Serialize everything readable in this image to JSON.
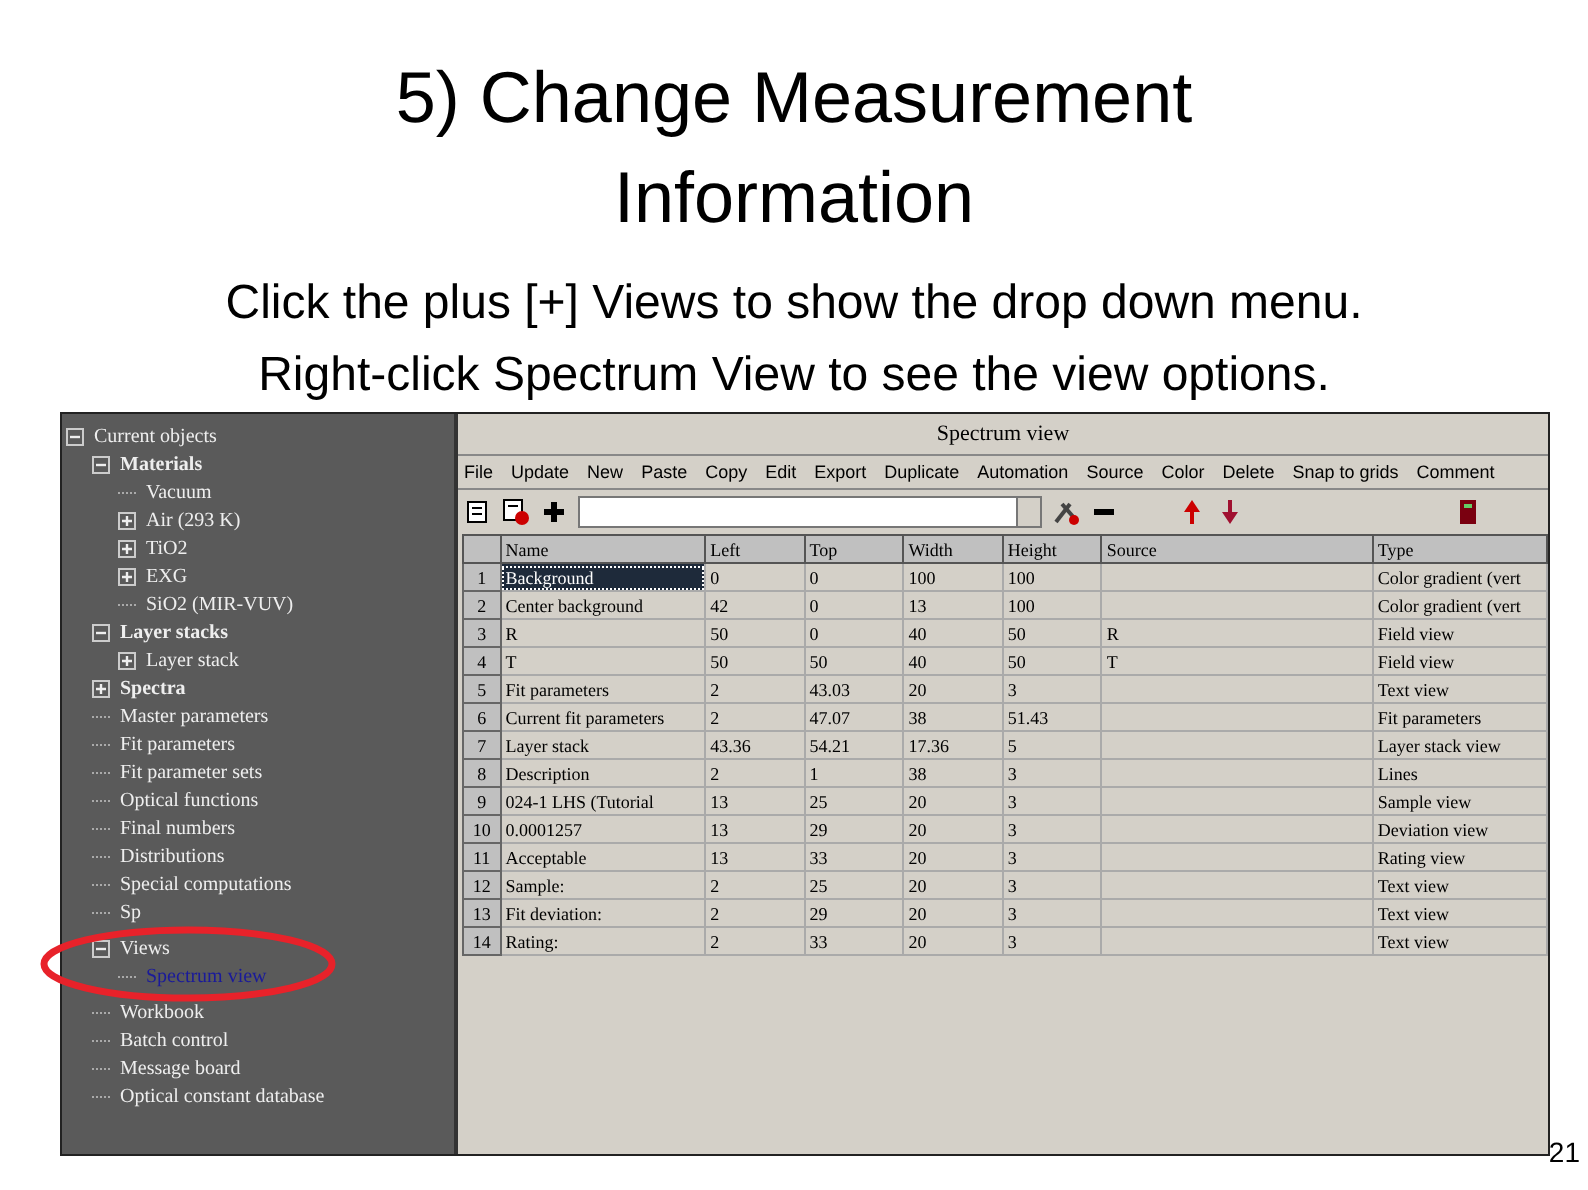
{
  "slide": {
    "title": [
      "5) Change Measurement",
      "Information"
    ],
    "subtitle": [
      "Click the plus [+] Views to show the drop down menu.",
      "Right-click Spectrum View to see the view options."
    ],
    "page_number": "21"
  },
  "tree": [
    {
      "label": "Current objects",
      "kind": "item",
      "expanded": true,
      "selected": false,
      "children": [
        {
          "label": "Materials",
          "kind": "group",
          "expanded": true,
          "selected": false,
          "children": [
            {
              "label": "Vacuum",
              "kind": "item",
              "selected": false
            },
            {
              "label": "Air (293 K)",
              "kind": "item",
              "expanded": false,
              "selected": false
            },
            {
              "label": "TiO2",
              "kind": "item",
              "expanded": false,
              "selected": false
            },
            {
              "label": "EXG",
              "kind": "item",
              "expanded": false,
              "selected": false
            },
            {
              "label": "SiO2 (MIR-VUV)",
              "kind": "item",
              "selected": false
            }
          ]
        },
        {
          "label": "Layer stacks",
          "kind": "group",
          "expanded": true,
          "selected": false,
          "children": [
            {
              "label": "Layer stack",
              "kind": "item",
              "expanded": false,
              "selected": false
            }
          ]
        },
        {
          "label": "Spectra",
          "kind": "group",
          "expanded": false,
          "selected": false
        },
        {
          "label": "Master parameters",
          "kind": "item",
          "selected": false
        },
        {
          "label": "Fit parameters",
          "kind": "item",
          "selected": false
        },
        {
          "label": "Fit parameter sets",
          "kind": "item",
          "selected": false
        },
        {
          "label": "Optical functions",
          "kind": "item",
          "selected": false
        },
        {
          "label": "Final numbers",
          "kind": "item",
          "selected": false
        },
        {
          "label": "Distributions",
          "kind": "item",
          "selected": false
        },
        {
          "label": "Special computations",
          "kind": "item",
          "selected": false
        },
        {
          "label": "Sp",
          "kind": "item",
          "selected": false
        },
        {
          "label": "Views",
          "kind": "item",
          "expanded": true,
          "highlighted": true,
          "selected": false,
          "children": [
            {
              "label": "Spectrum view",
              "kind": "item",
              "selected": true
            }
          ]
        },
        {
          "label": "Workbook",
          "kind": "item",
          "selected": false
        },
        {
          "label": "Batch control",
          "kind": "item",
          "selected": false
        },
        {
          "label": "Message board",
          "kind": "item",
          "selected": false
        },
        {
          "label": "Optical constant database",
          "kind": "item",
          "selected": false
        }
      ]
    }
  ],
  "window": {
    "title": "Spectrum view"
  },
  "menu": [
    "File",
    "Update",
    "New",
    "Paste",
    "Copy",
    "Edit",
    "Export",
    "Duplicate",
    "Automation",
    "Source",
    "Color",
    "Delete",
    "Snap to grids",
    "Comment"
  ],
  "table": {
    "columns": [
      "Name",
      "Left",
      "Top",
      "Width",
      "Height",
      "Source",
      "Type"
    ],
    "rows": [
      {
        "number": "1",
        "cells": [
          "Background",
          "0",
          "0",
          "100",
          "100",
          "",
          "Color gradient (vert"
        ],
        "selected": true
      },
      {
        "number": "2",
        "cells": [
          "Center background",
          "42",
          "0",
          "13",
          "100",
          "",
          "Color gradient (vert"
        ],
        "selected": false
      },
      {
        "number": "3",
        "cells": [
          "R",
          "50",
          "0",
          "40",
          "50",
          "R",
          "Field view"
        ],
        "selected": false
      },
      {
        "number": "4",
        "cells": [
          "T",
          "50",
          "50",
          "40",
          "50",
          "T",
          "Field view"
        ],
        "selected": false
      },
      {
        "number": "5",
        "cells": [
          "Fit parameters",
          "2",
          "43.03",
          "20",
          "3",
          "",
          "Text view"
        ],
        "selected": false
      },
      {
        "number": "6",
        "cells": [
          "Current fit parameters",
          "2",
          "47.07",
          "38",
          "51.43",
          "",
          "Fit parameters"
        ],
        "selected": false
      },
      {
        "number": "7",
        "cells": [
          "Layer stack",
          "43.36",
          "54.21",
          "17.36",
          "5",
          "",
          "Layer stack view"
        ],
        "selected": false
      },
      {
        "number": "8",
        "cells": [
          "Description",
          "2",
          "1",
          "38",
          "3",
          "",
          "Lines"
        ],
        "selected": false
      },
      {
        "number": "9",
        "cells": [
          "024-1 LHS (Tutorial",
          "13",
          "25",
          "20",
          "3",
          "",
          "Sample view"
        ],
        "selected": false
      },
      {
        "number": "10",
        "cells": [
          "0.0001257",
          "13",
          "29",
          "20",
          "3",
          "",
          "Deviation view"
        ],
        "selected": false
      },
      {
        "number": "11",
        "cells": [
          "Acceptable",
          "13",
          "33",
          "20",
          "3",
          "",
          "Rating view"
        ],
        "selected": false
      },
      {
        "number": "12",
        "cells": [
          "Sample:",
          "2",
          "25",
          "20",
          "3",
          "",
          "Text view"
        ],
        "selected": false
      },
      {
        "number": "13",
        "cells": [
          "Fit deviation:",
          "2",
          "29",
          "20",
          "3",
          "",
          "Text view"
        ],
        "selected": false
      },
      {
        "number": "14",
        "cells": [
          "Rating:",
          "2",
          "33",
          "20",
          "3",
          "",
          "Text view"
        ],
        "selected": false
      }
    ]
  }
}
